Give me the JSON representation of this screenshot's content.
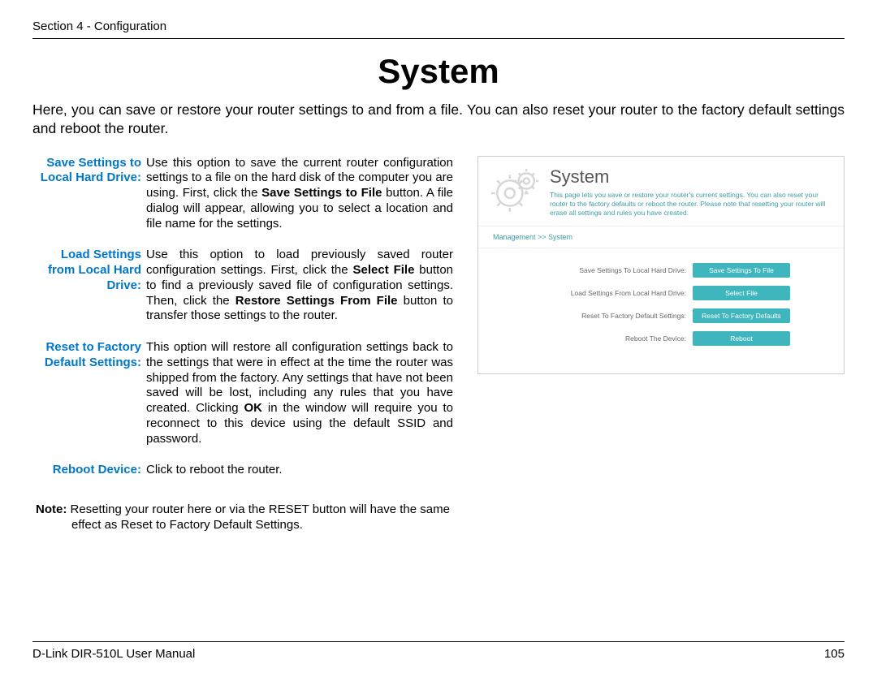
{
  "header": "Section 4 - Configuration",
  "title": "System",
  "intro_a": "Here, you can save or restore your router settings to and from a file. You can also reset your router to the factory default settings and reboot the router.",
  "defs": {
    "save_term": "Save Settings to Local Hard Drive:",
    "save_a": "Use this option to save the current router configuration settings to a file on the hard disk of the computer you are using. First, click the ",
    "save_b": "Save Settings to File",
    "save_c": " button. A file dialog will appear, allowing you to select a location and file name for the settings.",
    "load_term": "Load Settings from Local Hard Drive:",
    "load_a": "Use this option to load previously saved router configuration settings. First, click the ",
    "load_b": "Select File",
    "load_c": " button to find a previously saved file of configuration settings. Then, click the ",
    "load_d": "Restore Settings From File",
    "load_e": " button to transfer those settings to the router.",
    "reset_term": "Reset to Factory Default Settings:",
    "reset_a": "This option will restore all configuration settings back to the settings that were in effect at the time the router was shipped from the factory. Any settings that have not been saved will be lost, including any rules that you have created. Clicking ",
    "reset_b": "OK",
    "reset_c": " in the window will require you to reconnect to this device using the default SSID and password.",
    "reboot_term": "Reboot Device:",
    "reboot_desc": "Click to reboot the router."
  },
  "note_label": "Note:",
  "note_text": " Resetting your router here or via the RESET button will have the same effect as Reset to Factory Default Settings.",
  "panel": {
    "title": "System",
    "sub": "This page lets you save or restore your router's current settings. You can also reset your router to the factory defaults or reboot the router. Please note that resetting your router will erase all settings and rules you have created.",
    "breadcrumb": "Management  >>  System",
    "rows": [
      {
        "label": "Save Settings To Local Hard Drive:",
        "btn": "Save Settings To File"
      },
      {
        "label": "Load Settings From Local Hard Drive:",
        "btn": "Select File"
      },
      {
        "label": "Reset To Factory Default Settings:",
        "btn": "Reset To Factory Defaults"
      },
      {
        "label": "Reboot The Device:",
        "btn": "Reboot"
      }
    ]
  },
  "footer_left": "D-Link DIR-510L User Manual",
  "footer_right": "105"
}
